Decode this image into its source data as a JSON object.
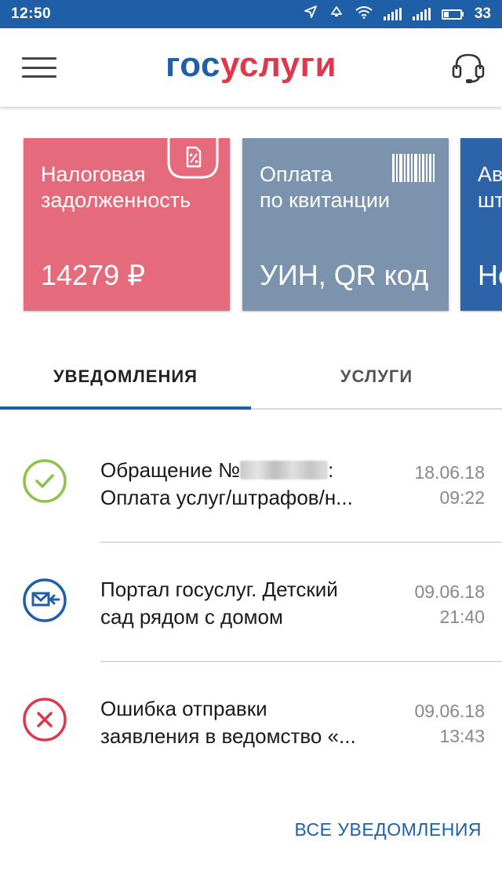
{
  "status_bar": {
    "time": "12:50",
    "battery": "33",
    "icons": [
      "navigation-arrow-icon",
      "notification-icon",
      "wifi-icon",
      "signal-icon",
      "signal-icon",
      "battery-icon"
    ]
  },
  "app_bar": {
    "logo_part1": "гос",
    "logo_part2": "услуги",
    "menu_icon": "hamburger-icon",
    "support_icon": "headset-icon"
  },
  "cards": [
    {
      "title_line1": "Налоговая",
      "title_line2": "задолженность",
      "value": "14279 ₽",
      "icon": "tax-document-icon",
      "color": "#e56b7c"
    },
    {
      "title_line1": "Оплата",
      "title_line2": "по квитанции",
      "value": "УИН, QR код",
      "icon": "barcode-icon",
      "color": "#7b93ad"
    },
    {
      "title_line1": "Ав",
      "title_line2": "шт",
      "value": "Не",
      "color": "#2d63a8"
    }
  ],
  "tabs": [
    {
      "label": "УВЕДОМЛЕНИЯ",
      "active": true
    },
    {
      "label": "УСЛУГИ",
      "active": false
    }
  ],
  "notifications": [
    {
      "line1_prefix": "Обращение №",
      "line1_suffix": ":",
      "line2": "Оплата услуг/штрафов/н...",
      "date": "18.06.18",
      "time": "09:22",
      "icon": "check-circle-icon",
      "status_color": "#8dc34a"
    },
    {
      "line1": "Портал госуслуг. Детский",
      "line2": "сад рядом с домом",
      "date": "09.06.18",
      "time": "21:40",
      "icon": "incoming-mail-icon",
      "status_color": "#1f5fa8"
    },
    {
      "line1": "Ошибка отправки",
      "line2": "заявления в ведомство «...",
      "date": "09.06.18",
      "time": "13:43",
      "icon": "error-circle-icon",
      "status_color": "#e0384b"
    }
  ],
  "all_notifications_label": "ВСЕ УВЕДОМЛЕНИЯ",
  "colors": {
    "primary": "#1f5fa8",
    "accent": "#e0384b"
  }
}
